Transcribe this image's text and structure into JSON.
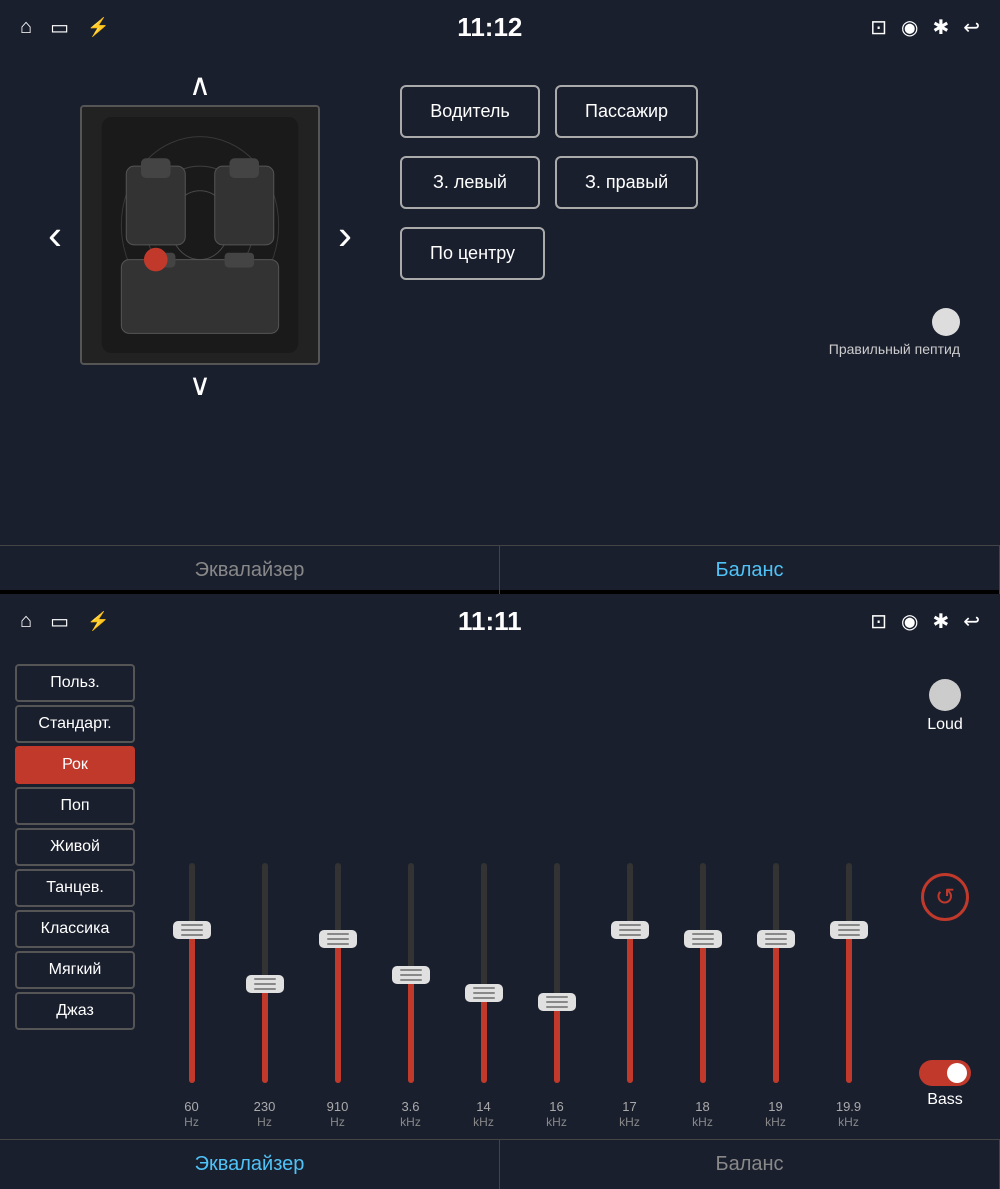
{
  "top_screen": {
    "time": "11:12",
    "nav": {
      "home_icon": "⌂",
      "screen_icon": "▭",
      "usb_icon": "⚡",
      "cast_icon": "⊡",
      "location_icon": "📍",
      "bluetooth_icon": "✱",
      "back_icon": "↩"
    },
    "seat_buttons": {
      "driver": "Водитель",
      "passenger": "Пассажир",
      "rear_left": "З. левый",
      "rear_right": "З. правый",
      "center": "По центру"
    },
    "balance_label": "Правильный пептид",
    "chevron_up": "∧",
    "chevron_down": "∨",
    "arrow_left": "‹",
    "arrow_right": "›",
    "tabs": {
      "equalizer": "Эквалайзер",
      "balance": "Баланс"
    },
    "active_tab": "balance"
  },
  "bottom_screen": {
    "time": "11:11",
    "presets": [
      {
        "id": "user",
        "label": "Польз.",
        "selected": false
      },
      {
        "id": "standard",
        "label": "Стандарт.",
        "selected": false
      },
      {
        "id": "rock",
        "label": "Рок",
        "selected": true
      },
      {
        "id": "pop",
        "label": "Поп",
        "selected": false
      },
      {
        "id": "live",
        "label": "Живой",
        "selected": false
      },
      {
        "id": "dance",
        "label": "Танцев.",
        "selected": false
      },
      {
        "id": "classic",
        "label": "Классика",
        "selected": false
      },
      {
        "id": "soft",
        "label": "Мягкий",
        "selected": false
      },
      {
        "id": "jazz",
        "label": "Джаз",
        "selected": false
      }
    ],
    "equalizer_bands": [
      {
        "freq": "60",
        "unit": "Hz",
        "value": 85
      },
      {
        "freq": "230",
        "unit": "Hz",
        "value": 55
      },
      {
        "freq": "910",
        "unit": "Hz",
        "value": 80
      },
      {
        "freq": "3.6",
        "unit": "kHz",
        "value": 60
      },
      {
        "freq": "14",
        "unit": "kHz",
        "value": 50
      },
      {
        "freq": "16",
        "unit": "kHz",
        "value": 45
      },
      {
        "freq": "17",
        "unit": "kHz",
        "value": 85
      },
      {
        "freq": "18",
        "unit": "kHz",
        "value": 80
      },
      {
        "freq": "19",
        "unit": "kHz",
        "value": 80
      },
      {
        "freq": "19.9",
        "unit": "kHz",
        "value": 85
      }
    ],
    "loud_label": "Loud",
    "bass_label": "Bass",
    "tabs": {
      "equalizer": "Эквалайзер",
      "balance": "Баланс"
    },
    "active_tab": "equalizer"
  }
}
